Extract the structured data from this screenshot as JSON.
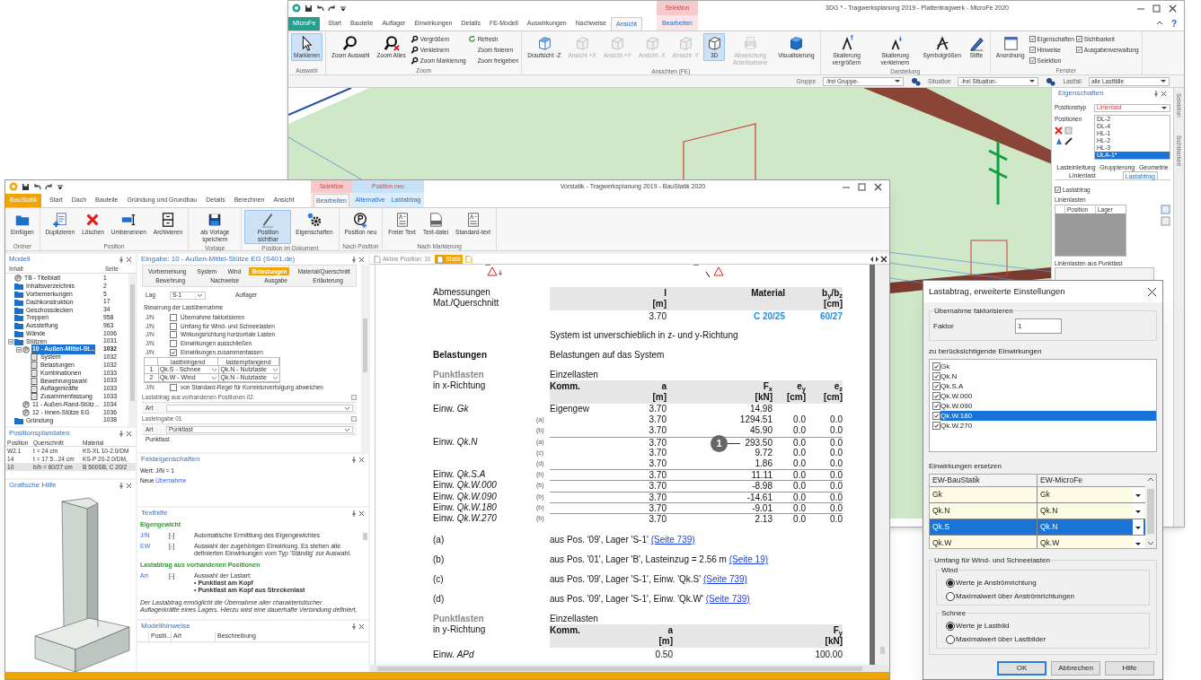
{
  "microfe": {
    "title": "3DG * - Tragwerksplanung 2019 - Plattentragwerk - MicroFe 2020",
    "app": "MicroFe",
    "help": "?",
    "tabs": [
      {
        "label": "Start",
        "selected": false
      },
      {
        "label": "Bauteile",
        "selected": false
      },
      {
        "label": "Auflager",
        "selected": false
      },
      {
        "label": "Einwirkungen",
        "selected": false
      },
      {
        "label": "Details",
        "selected": false
      },
      {
        "label": "FE-Modell",
        "selected": false
      },
      {
        "label": "Auswirkungen",
        "selected": false
      },
      {
        "label": "Nachweise",
        "selected": false
      },
      {
        "label": "Ansicht",
        "selected": true
      }
    ],
    "context_groups": [
      {
        "label": "Selektion",
        "tabs": [
          {
            "label": "Bearbeiten",
            "selected": false
          }
        ]
      }
    ],
    "ribbon": [
      {
        "label": "Auswahl",
        "items": [
          {
            "kind": "large",
            "label": "Markieren",
            "selected": true,
            "disabled": false
          }
        ]
      },
      {
        "label": "Zoom",
        "items": [
          {
            "kind": "large",
            "label": "Zoom Auswahl",
            "selected": false,
            "disabled": false
          },
          {
            "kind": "large",
            "label": "Zoom Alles",
            "selected": false,
            "disabled": false
          },
          {
            "kind": "small",
            "label": "Vergrößern"
          },
          {
            "kind": "small",
            "label": "Verkleinern"
          },
          {
            "kind": "small",
            "label": "Zoom Markierung"
          },
          {
            "kind": "small",
            "label": "Refresh"
          },
          {
            "kind": "small",
            "label": "Zoom fixieren"
          },
          {
            "kind": "small",
            "label": "Zoom freigeben"
          }
        ]
      },
      {
        "label": "Ansichten (FE)",
        "items": [
          {
            "kind": "large",
            "label": "Draufsicht -Z",
            "selected": false,
            "disabled": false
          },
          {
            "kind": "large",
            "label": "Ansicht +X",
            "selected": false,
            "disabled": true
          },
          {
            "kind": "large",
            "label": "Ansicht +Y",
            "selected": false,
            "disabled": true
          },
          {
            "kind": "large",
            "label": "Ansicht -X",
            "selected": false,
            "disabled": true
          },
          {
            "kind": "large",
            "label": "Ansicht -Y",
            "selected": false,
            "disabled": true
          },
          {
            "kind": "large",
            "label": "3D",
            "selected": true,
            "disabled": false
          },
          {
            "kind": "large",
            "label": "Abweichung Arbeitsebene",
            "selected": false,
            "disabled": true
          },
          {
            "kind": "large",
            "label": "Visualisierung",
            "selected": false,
            "disabled": false
          }
        ]
      },
      {
        "label": "Darstellung",
        "items": [
          {
            "kind": "large",
            "label": "Skalierung vergrößern",
            "selected": false,
            "disabled": false
          },
          {
            "kind": "large",
            "label": "Skalierung verkleinern",
            "selected": false,
            "disabled": false
          },
          {
            "kind": "large",
            "label": "Symbolgrößen",
            "selected": false,
            "disabled": false
          },
          {
            "kind": "large",
            "label": "Stifte",
            "selected": false,
            "disabled": false
          }
        ]
      },
      {
        "label": "Fenster",
        "items": [
          {
            "kind": "large",
            "label": "Anordnung",
            "selected": false,
            "disabled": false
          },
          {
            "kind": "check",
            "label": "Eigenschaften",
            "checked": true
          },
          {
            "kind": "check",
            "label": "Hinweise",
            "checked": true
          },
          {
            "kind": "check",
            "label": "Selektion",
            "checked": true
          },
          {
            "kind": "check",
            "label": "Sichtbarkeit",
            "checked": true
          },
          {
            "kind": "check",
            "label": "Ausgabenverwaltung",
            "checked": true
          }
        ]
      }
    ],
    "filters": [
      {
        "label": "Gruppe",
        "value": "-frei Gruppe-"
      },
      {
        "label": "Situation",
        "value": "-frei Situation-"
      },
      {
        "label": "Lastfall",
        "value": "alle Lastfälle"
      }
    ],
    "properties": {
      "title": "Eigenschaften",
      "type_label": "Positionstyp",
      "type_value": "Linienlast",
      "positions_label": "Positionen",
      "positions": [
        {
          "label": "DL-2",
          "selected": false
        },
        {
          "label": "DL-4",
          "selected": false
        },
        {
          "label": "HL-1",
          "selected": false
        },
        {
          "label": "HL-2",
          "selected": false
        },
        {
          "label": "HL-3",
          "selected": false
        },
        {
          "label": "ULA-1*",
          "selected": true
        }
      ],
      "tab_rows": [
        [
          {
            "label": "Lasteinleitung",
            "selected": false
          },
          {
            "label": "Gruppierung",
            "selected": false
          },
          {
            "label": "Geometrie",
            "selected": false
          }
        ],
        [
          {
            "label": "Linienlast",
            "selected": false
          },
          {
            "label": "Lastabtrag",
            "selected": true
          }
        ]
      ],
      "check": {
        "label": "Lastabtrag",
        "checked": true
      },
      "list1_label": "Linienlasten",
      "columns": [
        "Position",
        "Lager"
      ],
      "list2_label": "Linienlasten aus Punktlast"
    },
    "side_tabs": [
      "Selektion",
      "Sichtbarkeit"
    ]
  },
  "baustatik": {
    "title": "Vorstatik - Tragwerksplanung 2019 - BauStatik 2020",
    "app": "BauStatik",
    "tabs": [
      {
        "label": "Start",
        "selected": false
      },
      {
        "label": "Dach",
        "selected": false
      },
      {
        "label": "Bauteile",
        "selected": false
      },
      {
        "label": "Gründung und Grundbau",
        "selected": false
      },
      {
        "label": "Details",
        "selected": false
      },
      {
        "label": "Berechnen",
        "selected": false
      },
      {
        "label": "Ansicht",
        "selected": false
      }
    ],
    "context_groups": [
      {
        "label": "Selektion",
        "tabs": [
          {
            "label": "Bearbeiten",
            "selected": true
          }
        ]
      },
      {
        "label": "Position neu",
        "tabs": [
          {
            "label": "Alternative",
            "selected": false
          },
          {
            "label": "Lastabtrag",
            "selected": false
          }
        ]
      }
    ],
    "ribbon": [
      {
        "label": "Ordner",
        "items": [
          {
            "kind": "large",
            "label": "Einfügen",
            "selected": false
          }
        ]
      },
      {
        "label": "Position",
        "items": [
          {
            "kind": "large",
            "label": "Duplizieren",
            "selected": false
          },
          {
            "kind": "large",
            "label": "Löschen",
            "selected": false
          },
          {
            "kind": "large",
            "label": "Umbenennen",
            "selected": false
          },
          {
            "kind": "large",
            "label": "Archivieren",
            "selected": false
          }
        ]
      },
      {
        "label": "Vorlage",
        "items": [
          {
            "kind": "large",
            "label": "als Vorlage speichern",
            "selected": false
          }
        ]
      },
      {
        "label": "Position im Dokument",
        "items": [
          {
            "kind": "large",
            "label": "Position sichtbar",
            "selected": true
          },
          {
            "kind": "large",
            "label": "Eigenschaften",
            "selected": false
          }
        ]
      },
      {
        "label": "Nach Position",
        "items": [
          {
            "kind": "large",
            "label": "Position neu",
            "selected": false
          }
        ]
      },
      {
        "label": "Nach Markierung",
        "items": [
          {
            "kind": "large",
            "label": "Freier Text",
            "selected": false
          },
          {
            "kind": "large",
            "label": "Text-datei",
            "selected": false
          },
          {
            "kind": "large",
            "label": "Standard-text",
            "selected": false
          }
        ]
      }
    ],
    "model": {
      "title": "Modell",
      "columns": [
        "Inhalt",
        "Seite"
      ],
      "tree": [
        {
          "label": "TB - Titelblatt",
          "page": "1",
          "selected": false
        },
        {
          "label": "Inhaltsverzeichnis",
          "page": "2",
          "selected": false
        },
        {
          "label": "Vorbemerkungen",
          "page": "5",
          "selected": false
        },
        {
          "label": "Dachkonstruktion",
          "page": "17",
          "selected": false
        },
        {
          "label": "Geschossdecken",
          "page": "34",
          "selected": false
        },
        {
          "label": "Treppen",
          "page": "958",
          "selected": false
        },
        {
          "label": "Aussteifung",
          "page": "963",
          "selected": false
        },
        {
          "label": "Wände",
          "page": "1006",
          "selected": false
        },
        {
          "label": "Stützen",
          "page": "1031",
          "selected": false,
          "children": [
            {
              "label": "10 - Außen-Mittel-St...",
              "page": "1032",
              "selected": true,
              "children": [
                {
                  "label": "System",
                  "page": "1032",
                  "selected": false
                },
                {
                  "label": "Belastungen",
                  "page": "1032",
                  "selected": false
                },
                {
                  "label": "Kombinationen",
                  "page": "1033",
                  "selected": false
                },
                {
                  "label": "Bewehrungswahl",
                  "page": "1033",
                  "selected": false
                },
                {
                  "label": "Auflagerkräfte",
                  "page": "1033",
                  "selected": false
                },
                {
                  "label": "Zusammenfassung",
                  "page": "1033",
                  "selected": false
                }
              ]
            },
            {
              "label": "11 - Außen-Rand-Stütz...",
              "page": "1034",
              "selected": false
            },
            {
              "label": "12 - Innen-Stütze EG",
              "page": "1036",
              "selected": false
            }
          ]
        },
        {
          "label": "Gründung",
          "page": "1038",
          "selected": false
        }
      ]
    },
    "plan": {
      "title": "Positionsplandaten",
      "columns": [
        "Position",
        "Querschnitt",
        "Material"
      ],
      "rows": [
        {
          "cells": [
            "W2.1",
            "t = 24 cm",
            "KS-XL 10-2.0/DM"
          ],
          "selected": false
        },
        {
          "cells": [
            "14",
            "t = 17.5...24 cm",
            "KS-P 20-2.0/DM,"
          ],
          "selected": false
        },
        {
          "cells": [
            "10",
            "b/h = 60/27 cm",
            "B 500SB, C 20/2"
          ],
          "selected": true
        }
      ]
    },
    "graphic": {
      "title": "Grafische Hilfe"
    },
    "input": {
      "title": "Eingabe: 10 - Außen-Mittel-Stütze EG (S401.de)",
      "tab_rows": [
        [
          {
            "label": "Vorbemerkung",
            "selected": false
          },
          {
            "label": "System",
            "selected": false
          },
          {
            "label": "Wind",
            "selected": false
          },
          {
            "label": "Belastungen",
            "selected": true
          },
          {
            "label": "Material/Querschnitt",
            "selected": false
          }
        ],
        [
          {
            "label": "Bewehrung",
            "selected": false
          },
          {
            "label": "Nachweise",
            "selected": false
          },
          {
            "label": "Ausgabe",
            "selected": false
          },
          {
            "label": "Erläuterung",
            "selected": false
          }
        ]
      ],
      "lag": {
        "label": "Lag",
        "value": "S-1",
        "note": "Auflager"
      },
      "control_title": "Steuerung der Lastübernahme",
      "checks": [
        {
          "key": "J/N",
          "label": "Übernahme faktorisieren",
          "checked": false
        },
        {
          "key": "J/N",
          "label": "Umfang für Wind- und Schneelasten",
          "checked": false
        },
        {
          "key": "J/N",
          "label": "Wirkungsrichtung horizontale Lasten",
          "checked": false
        },
        {
          "key": "J/N",
          "label": "Einwirkungen ausschließen",
          "checked": false
        },
        {
          "key": "J/N",
          "label": "Einwirkungen zusammenfassen",
          "checked": true
        }
      ],
      "map_columns": [
        "lastbringend",
        "lastempfangend"
      ],
      "map_rows": [
        {
          "no": "1",
          "from": "Qk.S - Schnee",
          "to": "Qk.N - Nutzlaste"
        },
        {
          "no": "2",
          "from": "Qk.W - Wind",
          "to": "Qk.N - Nutzlaste"
        }
      ],
      "check_last": {
        "key": "J/N",
        "label": "von Standard-Regel für Korrekturverfolgung abweichen",
        "checked": false
      },
      "sections": [
        {
          "title": "Lastabtrag aus vorhandenen Positionen 02",
          "field": "Art"
        },
        {
          "title": "Lasteingabe 01",
          "field": "Art",
          "value": "Punktlast"
        }
      ],
      "last_row": "Punktlast"
    },
    "field_props": {
      "title": "Feldeigenschaften",
      "value": "Wert: J/N = 1",
      "prefix": "Neue",
      "link": "Übernahme"
    },
    "text_help": {
      "title": "Texthilfe",
      "blocks": [
        {
          "kind": "heading",
          "text": "Eigengewicht"
        },
        {
          "kind": "entry",
          "key": "J/N",
          "unit": "[-]",
          "text": "Automatische Ermittlung des Eigengewichtes"
        },
        {
          "kind": "entry",
          "key": "EW",
          "unit": "[-]",
          "text": "Auswahl der zugehörigen Einwirkung. Es stehen alle definierten Einwirkungen vom Typ 'Ständig' zur Auswahl."
        },
        {
          "kind": "heading",
          "text": "Lastabtrag aus vorhandenen Positionen"
        },
        {
          "kind": "entry",
          "key": "Art",
          "unit": "[-]",
          "text": "Auswahl der Lastart:",
          "bullets": [
            "• Punktlast am Kopf",
            "• Punktlast am Kopf aus Streckenlast"
          ]
        },
        {
          "kind": "note",
          "text": "Der Lastabtrag ermöglicht die Übernahme aller charakteristischer Auflagerkräfte eines Lagers. Hierzu wird eine dauerhafte Verbindung definiert,"
        }
      ]
    },
    "hints": {
      "title": "Modellhinweise",
      "columns": [
        "Positi...",
        "Art",
        "Beschreibung"
      ]
    },
    "document": {
      "tabs": [
        {
          "label": "Aktive Position: 10",
          "selected": false
        },
        {
          "label": "Statik",
          "selected": true
        }
      ],
      "dims": {
        "labels": [
          "Abmessungen",
          "Mat./Querschnitt"
        ],
        "columns": [
          {
            "head": "l",
            "unit": "[m]",
            "value": "3.70",
            "link": false
          },
          {
            "head": "Material",
            "value": "C 20/25",
            "link": true
          },
          {
            "head": "b$_{y}$/b$_{z}$",
            "unit": "[cm]",
            "value": "60/27",
            "link": true
          }
        ]
      },
      "system_note": "System ist unverschieblich in z- und y-Richtung",
      "loads_label": "Belastungen",
      "loads_text": "Belastungen auf das System",
      "x_loads": {
        "title": "Punktlasten",
        "subtitle": "in x-Richtung",
        "caption": "Einzellasten",
        "columns": [
          {
            "head": "Komm."
          },
          {
            "head": "a",
            "unit": "[m]"
          },
          {
            "head": "F$_{x}$",
            "unit": "[kN]"
          },
          {
            "head": "e$_{y}$",
            "unit": "[cm]"
          },
          {
            "head": "e$_{z}$",
            "unit": "[cm]"
          }
        ],
        "groups": [
          {
            "label": "Einw. *Gk*",
            "rows": [
              {
                "note": "",
                "cells": [
                  "Eigengew",
                  "3.70",
                  "14.98",
                  "",
                  ""
                ]
              },
              {
                "note": "(a)",
                "cells": [
                  "",
                  "3.70",
                  "1294.51",
                  "0.0",
                  "0.0"
                ]
              },
              {
                "note": "(b)",
                "cells": [
                  "",
                  "3.70",
                  "45.90",
                  "0.0",
                  "0.0"
                ]
              }
            ]
          },
          {
            "label": "Einw. *Qk.N*",
            "rows": [
              {
                "note": "(a)",
                "cells": [
                  "",
                  "3.70",
                  "293.50",
                  "0.0",
                  "0.0"
                ],
                "callout": "1"
              },
              {
                "note": "(c)",
                "cells": [
                  "",
                  "3.70",
                  "9.72",
                  "0.0",
                  "0.0"
                ]
              },
              {
                "note": "(d)",
                "cells": [
                  "",
                  "3.70",
                  "1.86",
                  "0.0",
                  "0.0"
                ]
              }
            ]
          },
          {
            "label": "Einw. *Qk.S.A*",
            "rows": [
              {
                "note": "(b)",
                "cells": [
                  "",
                  "3.70",
                  "11.11",
                  "0.0",
                  "0.0"
                ]
              }
            ]
          },
          {
            "label": "Einw. *Qk.W.000*",
            "rows": [
              {
                "note": "(b)",
                "cells": [
                  "",
                  "3.70",
                  "-8.98",
                  "0.0",
                  "0.0"
                ]
              }
            ]
          },
          {
            "label": "Einw. *Qk.W.090*",
            "rows": [
              {
                "note": "(b)",
                "cells": [
                  "",
                  "3.70",
                  "-14.61",
                  "0.0",
                  "0.0"
                ]
              }
            ]
          },
          {
            "label": "Einw. *Qk.W.180*",
            "rows": [
              {
                "note": "(b)",
                "cells": [
                  "",
                  "3.70",
                  "-9.01",
                  "0.0",
                  "0.0"
                ]
              }
            ]
          },
          {
            "label": "Einw. *Qk.W.270*",
            "rows": [
              {
                "note": "(b)",
                "cells": [
                  "",
                  "3.70",
                  "2.13",
                  "0.0",
                  "0.0"
                ]
              }
            ]
          }
        ]
      },
      "footnotes": [
        {
          "mark": "(a)",
          "text": "aus Pos. '09', Lager 'S-1'",
          "link": "(Seite 739)"
        },
        {
          "mark": "(b)",
          "text": "aus Pos. '01', Lager 'B', Lasteinzug = 2.56 m",
          "link": "(Seite 19)"
        },
        {
          "mark": "(c)",
          "text": "aus Pos. '09', Lager 'S-1', Einw. 'Qk.S'",
          "link": "(Seite 739)"
        },
        {
          "mark": "(d)",
          "text": "aus Pos. '09', Lager 'S-1', Einw. 'Qk.W'",
          "link": "(Seite 739)"
        }
      ],
      "y_loads": {
        "title": "Punktlasten",
        "subtitle": "in y-Richtung",
        "caption": "Einzellasten",
        "columns": [
          {
            "head": "Komm."
          },
          {
            "head": "a",
            "unit": "[m]"
          },
          {
            "head": "F$_{y}$",
            "unit": "[kN]"
          }
        ],
        "rows": [
          {
            "label": "Einw. *APd*",
            "cells": [
              "",
              "0.50",
              "100.00"
            ]
          }
        ]
      }
    }
  },
  "dialog": {
    "title": "Lastabtrag, erweiterte Einstellungen",
    "factor_group": "Übernahme faktorisieren",
    "factor_label": "Faktor",
    "factor_value": "1",
    "actions_label": "zu berücksichtigende Einwirkungen",
    "actions": [
      {
        "label": "Gk",
        "checked": true,
        "selected": false
      },
      {
        "label": "Qk.N",
        "checked": true,
        "selected": false
      },
      {
        "label": "Qk.S.A",
        "checked": true,
        "selected": false
      },
      {
        "label": "Qk.W.000",
        "checked": true,
        "selected": false
      },
      {
        "label": "Qk.W.090",
        "checked": true,
        "selected": false
      },
      {
        "label": "Qk.W.180",
        "checked": true,
        "selected": true
      },
      {
        "label": "Qk.W.270",
        "checked": true,
        "selected": false
      }
    ],
    "replace_label": "Einwirkungen ersetzen",
    "replace_columns": [
      "EW-BauStatik",
      "EW-MicroFe"
    ],
    "replace_rows": [
      {
        "from": "Gk",
        "to": "Gk",
        "selected": false
      },
      {
        "from": "Qk.N",
        "to": "Qk.N",
        "selected": false
      },
      {
        "from": "Qk.S",
        "to": "Qk.N",
        "selected": true
      },
      {
        "from": "Qk.W",
        "to": "Qk.W",
        "selected": false
      }
    ],
    "scope_group": "Umfang für Wind- und Schneelasten",
    "scope": [
      {
        "title": "Wind",
        "options": [
          {
            "label": "Werte je Anströmrichtung",
            "selected": true
          },
          {
            "label": "Maximalwert über Anströmrichtungen",
            "selected": false
          }
        ]
      },
      {
        "title": "Schnee",
        "options": [
          {
            "label": "Werte je Lastbild",
            "selected": true
          },
          {
            "label": "Maximalwert über Lastbilder",
            "selected": false
          }
        ]
      }
    ],
    "buttons": [
      {
        "label": "OK",
        "default": true
      },
      {
        "label": "Abbrechen",
        "default": false
      },
      {
        "label": "Hilfe",
        "default": false
      }
    ]
  }
}
